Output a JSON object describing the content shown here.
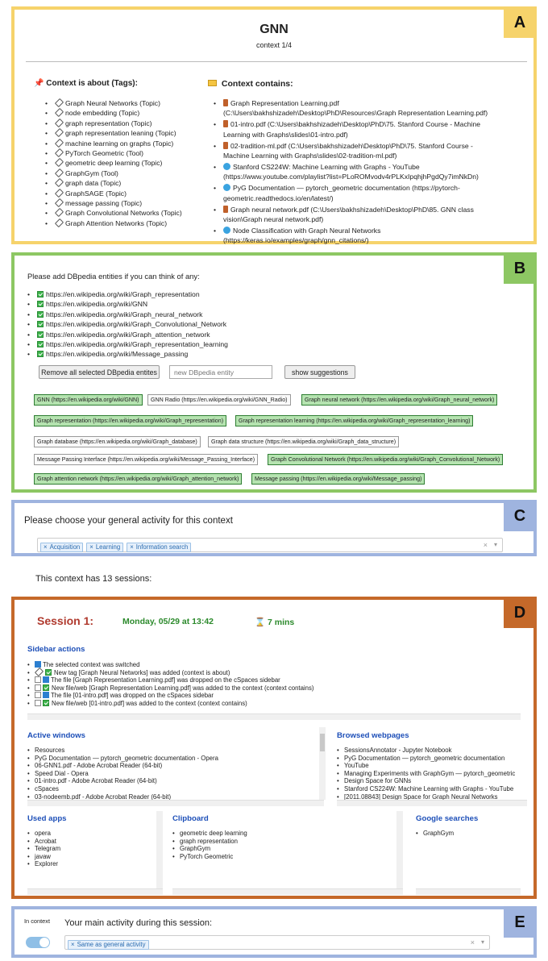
{
  "a": {
    "letter": "A",
    "title": "GNN",
    "subtitle": "context 1/4",
    "about_heading": "Context is about (Tags):",
    "contains_heading": "Context contains:",
    "tags": [
      "Graph Neural Networks (Topic)",
      "node embedding (Topic)",
      "graph representation (Topic)",
      "graph representation leaning (Topic)",
      "machine learning on graphs (Topic)",
      "PyTorch Geometric (Tool)",
      "geometric deep learning (Topic)",
      "GraphGym (Tool)",
      "graph data (Topic)",
      "GraphSAGE (Topic)",
      "message passing (Topic)",
      "Graph Convolutional Networks (Topic)",
      "Graph Attention Networks (Topic)"
    ],
    "items": [
      {
        "icon": "pdf",
        "l1": "Graph Representation Learning.pdf",
        "l2": "(C:\\Users\\bakhshizadeh\\Desktop\\PhD\\Resources\\Graph Representation Learning.pdf)"
      },
      {
        "icon": "pdf",
        "l1": "01-intro.pdf (C:\\Users\\bakhshizadeh\\Desktop\\PhD\\75. Stanford Course - Machine",
        "l2": "Learning with Graphs\\slides\\01-intro.pdf)"
      },
      {
        "icon": "pdf",
        "l1": "02-tradition-ml.pdf (C:\\Users\\bakhshizadeh\\Desktop\\PhD\\75. Stanford Course -",
        "l2": "Machine Learning with Graphs\\slides\\02-tradition-ml.pdf)"
      },
      {
        "icon": "web",
        "l1": "Stanford CS224W: Machine Learning with Graphs - YouTube",
        "l2": "(https://www.youtube.com/playlist?list=PLoROMvodv4rPLKxIpqhjhPgdQy7imNkDn)"
      },
      {
        "icon": "web",
        "l1": "PyG Documentation — pytorch_geometric documentation (https://pytorch-",
        "l2": "geometric.readthedocs.io/en/latest/)"
      },
      {
        "icon": "pdf",
        "l1": "Graph neural network.pdf (C:\\Users\\bakhshizadeh\\Desktop\\PhD\\85. GNN class",
        "l2": "vision\\Graph neural network.pdf)"
      },
      {
        "icon": "web",
        "l1": "Node Classification with Graph Neural Networks",
        "l2": "(https://keras.io/examples/graph/gnn_citations/)"
      }
    ]
  },
  "b": {
    "letter": "B",
    "prompt": "Please add DBpedia entities if you can think of any:",
    "entities": [
      "https://en.wikipedia.org/wiki/Graph_representation",
      "https://en.wikipedia.org/wiki/GNN",
      "https://en.wikipedia.org/wiki/Graph_neural_network",
      "https://en.wikipedia.org/wiki/Graph_Convolutional_Network",
      "https://en.wikipedia.org/wiki/Graph_attention_network",
      "https://en.wikipedia.org/wiki/Graph_representation_learning",
      "https://en.wikipedia.org/wiki/Message_passing"
    ],
    "remove_btn": "Remove all selected DBpedia entites",
    "new_placeholder": "new DBpedia entity",
    "suggest_btn": "show suggestions",
    "chips": [
      {
        "t": "GNN (https://en.wikipedia.org/wiki/GNN)",
        "on": true
      },
      {
        "t": "GNN Radio (https://en.wikipedia.org/wiki/GNN_Radio)",
        "on": false
      },
      {
        "t": "Graph neural network (https://en.wikipedia.org/wiki/Graph_neural_network)",
        "on": true
      },
      {
        "t": "Graph representation (https://en.wikipedia.org/wiki/Graph_representation)",
        "on": true
      },
      {
        "t": "Graph representation learning (https://en.wikipedia.org/wiki/Graph_representation_learning)",
        "on": true
      },
      {
        "t": "Graph database (https://en.wikipedia.org/wiki/Graph_database)",
        "on": false
      },
      {
        "t": "Graph data structure (https://en.wikipedia.org/wiki/Graph_data_structure)",
        "on": false
      },
      {
        "t": "Message Passing Interface (https://en.wikipedia.org/wiki/Message_Passing_Interface)",
        "on": false
      },
      {
        "t": "Graph Convolutional Network (https://en.wikipedia.org/wiki/Graph_Convolutional_Network)",
        "on": true
      },
      {
        "t": "Graph attention network (https://en.wikipedia.org/wiki/Graph_attention_network)",
        "on": true
      },
      {
        "t": "Message passing (https://en.wikipedia.org/wiki/Message_passing)",
        "on": true
      }
    ]
  },
  "c": {
    "letter": "C",
    "prompt": "Please choose your general activity for this context",
    "tokens": [
      "Acquisition",
      "Learning",
      "Information search"
    ],
    "clear": "×",
    "caret": "▾",
    "token_x": "×"
  },
  "sessions_text": "This context has 13 sessions:",
  "d": {
    "letter": "D",
    "session_title": "Session 1:",
    "date": "Monday, 05/29 at 13:42",
    "duration": "7 mins",
    "sidebar_heading": "Sidebar actions",
    "actions": [
      {
        "icons": [
          "blue"
        ],
        "text": "The selected context was switched"
      },
      {
        "icons": [
          "tag",
          "chk"
        ],
        "text": "New tag [Graph Neural Networks] was added (context is about)"
      },
      {
        "icons": [
          "box",
          "blue"
        ],
        "text": "The file [Graph Representation Learning.pdf] was dropped on the cSpaces sidebar"
      },
      {
        "icons": [
          "box",
          "chk"
        ],
        "text": "New file/web [Graph Representation Learning.pdf] was added to the context (context contains)"
      },
      {
        "icons": [
          "box",
          "blue"
        ],
        "text": "The file [01-intro.pdf] was dropped on the cSpaces sidebar"
      },
      {
        "icons": [
          "box",
          "chk"
        ],
        "text": "New file/web [01-intro.pdf] was added to the context (context contains)"
      }
    ],
    "active_heading": "Active windows",
    "active": [
      "Resources",
      "PyG Documentation — pytorch_geometric documentation - Opera",
      "06-GNN1.pdf - Adobe Acrobat Reader (64-bit)",
      "Speed Dial - Opera",
      "01-intro.pdf - Adobe Acrobat Reader (64-bit)",
      "cSpaces",
      "03-nodeemb.pdf - Adobe Acrobat Reader (64-bit)"
    ],
    "browsed_heading": "Browsed webpages",
    "browsed": [
      "SessionsAnnotator - Jupyter Notebook",
      "PyG Documentation — pytorch_geometric documentation",
      "YouTube",
      "Managing Experiments with GraphGym — pytorch_geometric",
      "Design Space for GNNs",
      "Stanford CS224W: Machine Learning with Graphs - YouTube",
      "[2011.08843] Design Space for Graph Neural Networks"
    ],
    "apps_heading": "Used apps",
    "apps": [
      "opera",
      "Acrobat",
      "Telegram",
      "javaw",
      "Explorer"
    ],
    "clip_heading": "Clipboard",
    "clip": [
      "geometric deep learning",
      "graph representation",
      "GraphGym",
      "PyTorch Geometric"
    ],
    "google_heading": "Google searches",
    "google": [
      "GraphGym"
    ]
  },
  "e": {
    "letter": "E",
    "in_context": "In context",
    "prompt": "Your main activity during this session:",
    "token": "Same as general activity",
    "clear": "×",
    "caret": "▾",
    "token_x": "×"
  },
  "colors": {
    "a": "#f6d36b",
    "b": "#8dc763",
    "c": "#9fb4df",
    "d": "#c5692a",
    "e": "#9fb4df",
    "session": "#b03a2e",
    "date": "#2c8a2c"
  }
}
